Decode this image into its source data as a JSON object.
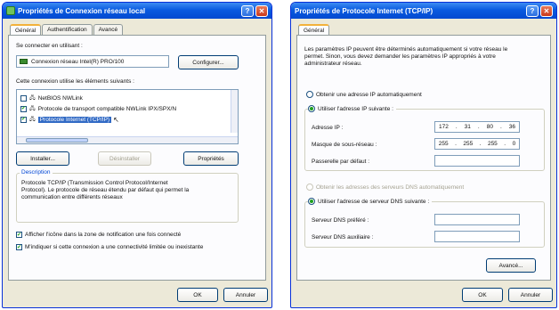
{
  "left": {
    "title": "Propriétés de Connexion réseau local",
    "tabs": [
      "Général",
      "Authentification",
      "Avancé"
    ],
    "connect_label": "Se connecter en utilisant :",
    "adapter": "Connexion réseau Intel(R) PRO/100",
    "configure": "Configurer...",
    "items_label": "Cette connexion utilise les éléments suivants :",
    "items": [
      "NetBIOS NWLink",
      "Protocole de transport compatible NWLink IPX/SPX/N",
      "Protocole Internet (TCP/IP)"
    ],
    "install": "Installer...",
    "uninstall": "Désinstaller",
    "properties": "Propriétés",
    "description_title": "Description",
    "description": "Protocole TCP/IP (Transmission Control Protocol/Internet Protocol). Le protocole de réseau étendu par défaut qui permet la communication entre différents réseaux",
    "notify": "Afficher l'icône dans la zone de notification une fois connecté",
    "limited": "M'indiquer si cette connexion a une connectivité limitée ou inexistante",
    "ok": "OK",
    "cancel": "Annuler"
  },
  "right": {
    "title": "Propriétés de Protocole Internet (TCP/IP)",
    "tab": "Général",
    "intro": "Les paramètres IP peuvent être déterminés automatiquement si votre réseau le permet. Sinon, vous devez demander les paramètres IP appropriés à votre administrateur réseau.",
    "auto_ip": "Obtenir une adresse IP automatiquement",
    "use_ip": "Utiliser l'adresse IP suivante :",
    "ip_label": "Adresse IP :",
    "ip": [
      "172",
      "31",
      "80",
      "36"
    ],
    "mask_label": "Masque de sous-réseau :",
    "mask": [
      "255",
      "255",
      "255",
      "0"
    ],
    "gateway_label": "Passerelle par défaut :",
    "auto_dns": "Obtenir les adresses des serveurs DNS automatiquement",
    "use_dns": "Utiliser l'adresse de serveur DNS suivante :",
    "dns1_label": "Serveur DNS préféré :",
    "dns2_label": "Serveur DNS auxiliaire :",
    "advanced": "Avancé...",
    "ok": "OK",
    "cancel": "Annuler"
  },
  "colors": {
    "titlebar": "#0a5be0",
    "dialog": "#ece9d8",
    "check": "#21a121"
  },
  "help_glyph": "?",
  "close_glyph": "✕"
}
